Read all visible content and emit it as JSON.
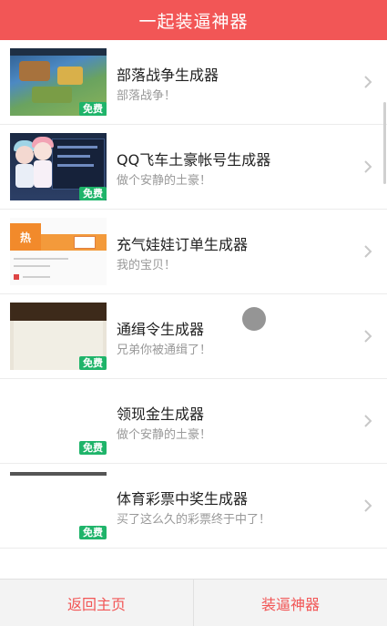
{
  "header": {
    "title": "一起装逼神器"
  },
  "badge_label": "免费",
  "items": [
    {
      "title": "部落战争生成器",
      "subtitle": "部落战争！",
      "free": true,
      "thumb": "game"
    },
    {
      "title": "QQ飞车土豪帐号生成器",
      "subtitle": "做个安静的土豪！",
      "free": true,
      "thumb": "anime"
    },
    {
      "title": "充气娃娃订单生成器",
      "subtitle": "我的宝贝！",
      "free": false,
      "thumb": "order"
    },
    {
      "title": "通缉令生成器",
      "subtitle": "兄弟你被通缉了！",
      "free": true,
      "thumb": "wanted"
    },
    {
      "title": "领现金生成器",
      "subtitle": "做个安静的土豪！",
      "free": true,
      "thumb": "cash"
    },
    {
      "title": "体育彩票中奖生成器",
      "subtitle": "买了这么久的彩票终于中了！",
      "free": true,
      "thumb": "lottery"
    }
  ],
  "thumb_texts": {
    "hot": "热"
  },
  "footer": {
    "home_label": "返回主页",
    "tools_label": "装逼神器"
  },
  "colors": {
    "accent": "#f25656",
    "badge": "#1fb46a"
  }
}
